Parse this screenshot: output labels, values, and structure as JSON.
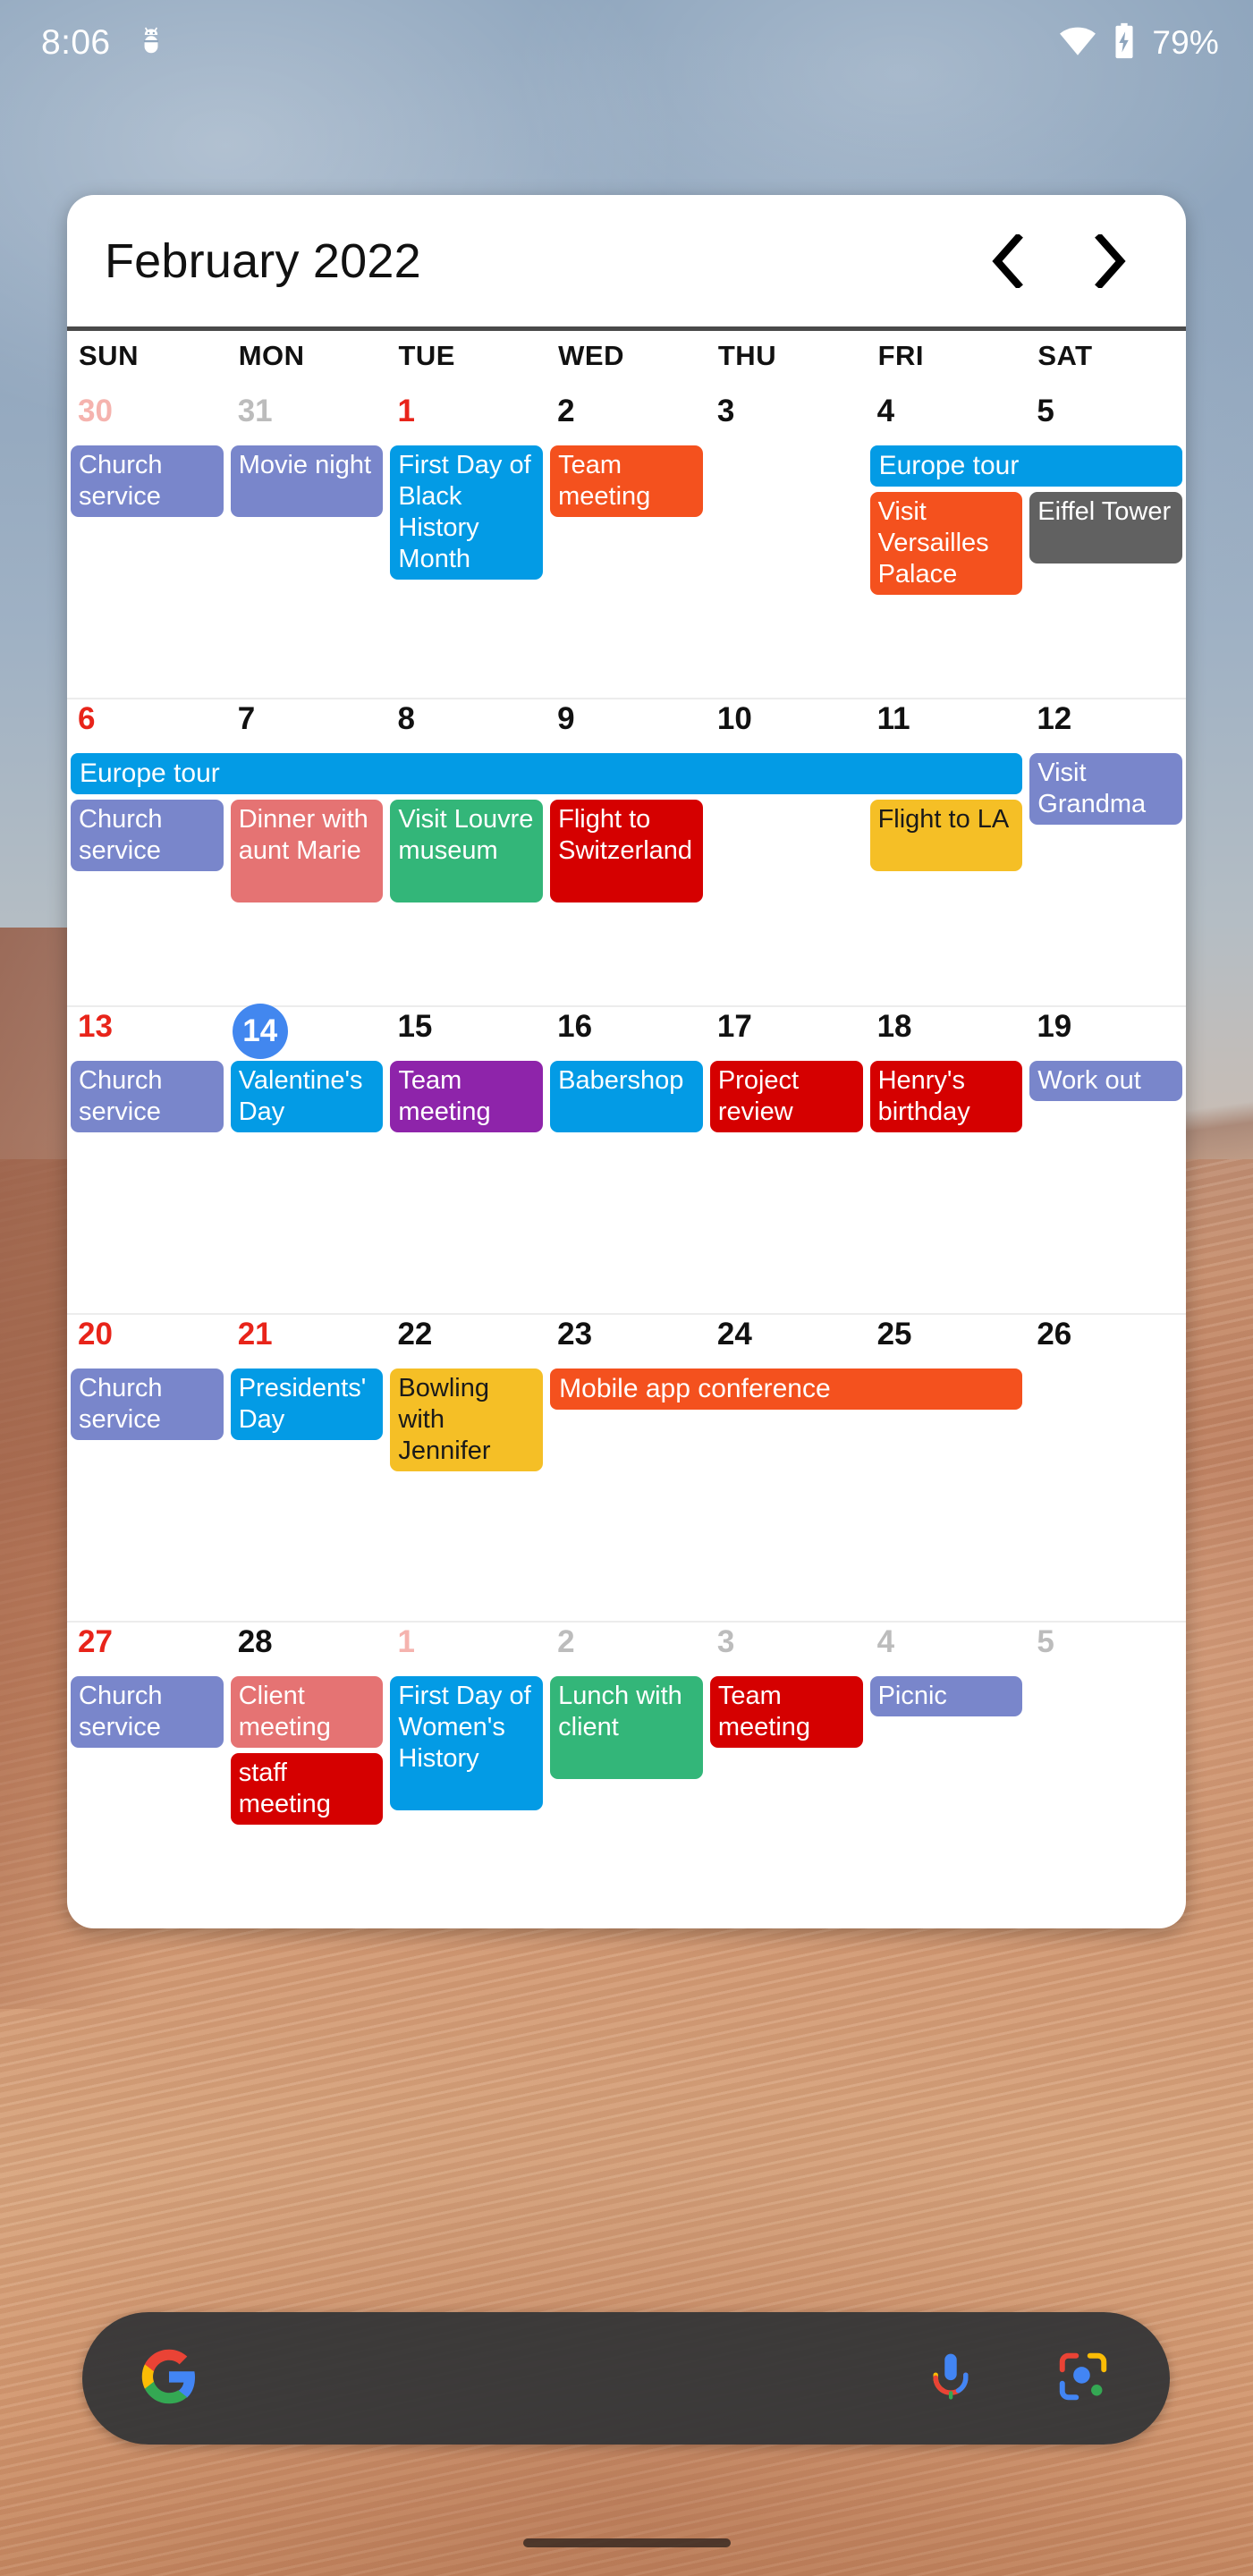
{
  "statusbar": {
    "time": "8:06",
    "debug_icon": "android-bug-icon",
    "wifi_icon": "wifi-icon",
    "battery_icon": "battery-charging-icon",
    "battery_percent": "79%"
  },
  "widget": {
    "title": "February 2022",
    "prev_label": "❮",
    "next_label": "❯",
    "weekdays": [
      "SUN",
      "MON",
      "TUE",
      "WED",
      "THU",
      "FRI",
      "SAT"
    ],
    "today": 14,
    "colors": {
      "periwinkle": "#7986cb",
      "blue": "#039be5",
      "orange": "#f4511e",
      "gray": "#616161",
      "salmon": "#e57373",
      "green": "#33b679",
      "red": "#d50000",
      "yellow": "#f5bf26",
      "purple": "#8e24aa",
      "today_circle": "#4287ef",
      "holiday_text": "#e8241a",
      "muted_text": "#bcbcbc"
    },
    "weeks": [
      {
        "days": [
          {
            "num": "30",
            "style": "out sun"
          },
          {
            "num": "31",
            "style": "out"
          },
          {
            "num": "1",
            "style": "hol"
          },
          {
            "num": "2",
            "style": ""
          },
          {
            "num": "3",
            "style": ""
          },
          {
            "num": "4",
            "style": ""
          },
          {
            "num": "5",
            "style": ""
          }
        ],
        "events": [
          {
            "title": "Church service",
            "col": 0,
            "span": 1,
            "row": 0,
            "lines": 2,
            "color": "periwinkle",
            "text": "light"
          },
          {
            "title": "Movie night",
            "col": 1,
            "span": 1,
            "row": 0,
            "lines": 2,
            "color": "periwinkle",
            "text": "light"
          },
          {
            "title": "First Day of Black History Month",
            "col": 2,
            "span": 1,
            "row": 0,
            "lines": 4,
            "color": "blue",
            "text": "light"
          },
          {
            "title": "Team meeting",
            "col": 3,
            "span": 1,
            "row": 0,
            "lines": 2,
            "color": "orange",
            "text": "light"
          },
          {
            "title": "Europe tour",
            "col": 5,
            "span": 2,
            "row": 0,
            "lines": 1,
            "color": "blue",
            "text": "light",
            "bar": true
          },
          {
            "title": "Visit Versailles Palace",
            "col": 5,
            "span": 1,
            "row": 1,
            "lines": 3,
            "color": "orange",
            "text": "light"
          },
          {
            "title": "Eiffel Tower",
            "col": 6,
            "span": 1,
            "row": 1,
            "lines": 2,
            "color": "gray",
            "text": "light"
          }
        ]
      },
      {
        "days": [
          {
            "num": "6",
            "style": "sun"
          },
          {
            "num": "7",
            "style": ""
          },
          {
            "num": "8",
            "style": ""
          },
          {
            "num": "9",
            "style": ""
          },
          {
            "num": "10",
            "style": ""
          },
          {
            "num": "11",
            "style": ""
          },
          {
            "num": "12",
            "style": ""
          }
        ],
        "events": [
          {
            "title": "Europe tour",
            "col": 0,
            "span": 6,
            "row": 0,
            "lines": 1,
            "color": "blue",
            "text": "light",
            "bar": true
          },
          {
            "title": "Church service",
            "col": 0,
            "span": 1,
            "row": 1,
            "lines": 2,
            "color": "periwinkle",
            "text": "light"
          },
          {
            "title": "Dinner with aunt Marie",
            "col": 1,
            "span": 1,
            "row": 1,
            "lines": 3,
            "color": "salmon",
            "text": "light"
          },
          {
            "title": "Visit Louvre museum",
            "col": 2,
            "span": 1,
            "row": 1,
            "lines": 3,
            "color": "green",
            "text": "light"
          },
          {
            "title": "Flight to Switzerland",
            "col": 3,
            "span": 1,
            "row": 1,
            "lines": 3,
            "color": "red",
            "text": "light"
          },
          {
            "title": "Flight to LA",
            "col": 5,
            "span": 1,
            "row": 1,
            "lines": 2,
            "color": "yellow",
            "text": "dark"
          },
          {
            "title": "Visit Grandma",
            "col": 6,
            "span": 1,
            "row": 0,
            "lines": 2,
            "color": "periwinkle",
            "text": "light"
          }
        ]
      },
      {
        "days": [
          {
            "num": "13",
            "style": "sun"
          },
          {
            "num": "14",
            "style": "today"
          },
          {
            "num": "15",
            "style": ""
          },
          {
            "num": "16",
            "style": ""
          },
          {
            "num": "17",
            "style": ""
          },
          {
            "num": "18",
            "style": ""
          },
          {
            "num": "19",
            "style": ""
          }
        ],
        "events": [
          {
            "title": "Church service",
            "col": 0,
            "span": 1,
            "row": 0,
            "lines": 2,
            "color": "periwinkle",
            "text": "light"
          },
          {
            "title": "Valentine's Day",
            "col": 1,
            "span": 1,
            "row": 0,
            "lines": 2,
            "color": "blue",
            "text": "light"
          },
          {
            "title": "Team meeting",
            "col": 2,
            "span": 1,
            "row": 0,
            "lines": 2,
            "color": "purple",
            "text": "light"
          },
          {
            "title": "Babershop",
            "col": 3,
            "span": 1,
            "row": 0,
            "lines": 2,
            "color": "blue",
            "text": "light"
          },
          {
            "title": "Project review",
            "col": 4,
            "span": 1,
            "row": 0,
            "lines": 2,
            "color": "red",
            "text": "light"
          },
          {
            "title": "Henry's birthday",
            "col": 5,
            "span": 1,
            "row": 0,
            "lines": 2,
            "color": "red",
            "text": "light"
          },
          {
            "title": "Work out",
            "col": 6,
            "span": 1,
            "row": 0,
            "lines": 1,
            "color": "periwinkle",
            "text": "light"
          }
        ]
      },
      {
        "days": [
          {
            "num": "20",
            "style": "sun"
          },
          {
            "num": "21",
            "style": "hol"
          },
          {
            "num": "22",
            "style": ""
          },
          {
            "num": "23",
            "style": ""
          },
          {
            "num": "24",
            "style": ""
          },
          {
            "num": "25",
            "style": ""
          },
          {
            "num": "26",
            "style": ""
          }
        ],
        "events": [
          {
            "title": "Church service",
            "col": 0,
            "span": 1,
            "row": 0,
            "lines": 2,
            "color": "periwinkle",
            "text": "light"
          },
          {
            "title": "Presidents' Day",
            "col": 1,
            "span": 1,
            "row": 0,
            "lines": 2,
            "color": "blue",
            "text": "light"
          },
          {
            "title": "Bowling with Jennifer",
            "col": 2,
            "span": 1,
            "row": 0,
            "lines": 3,
            "color": "yellow",
            "text": "dark"
          },
          {
            "title": "Mobile app conference",
            "col": 3,
            "span": 3,
            "row": 0,
            "lines": 1,
            "color": "orange",
            "text": "light",
            "bar": true
          }
        ]
      },
      {
        "days": [
          {
            "num": "27",
            "style": "sun"
          },
          {
            "num": "28",
            "style": ""
          },
          {
            "num": "1",
            "style": "out sun"
          },
          {
            "num": "2",
            "style": "out"
          },
          {
            "num": "3",
            "style": "out"
          },
          {
            "num": "4",
            "style": "out"
          },
          {
            "num": "5",
            "style": "out"
          }
        ],
        "events": [
          {
            "title": "Church service",
            "col": 0,
            "span": 1,
            "row": 0,
            "lines": 2,
            "color": "periwinkle",
            "text": "light"
          },
          {
            "title": "Client meeting",
            "col": 1,
            "span": 1,
            "row": 0,
            "lines": 2,
            "color": "salmon",
            "text": "light"
          },
          {
            "title": "staff meeting",
            "col": 1,
            "span": 1,
            "row": 1,
            "lines": 2,
            "color": "red",
            "text": "light"
          },
          {
            "title": "First Day of Women's History",
            "col": 2,
            "span": 1,
            "row": 0,
            "lines": 4,
            "color": "blue",
            "text": "light"
          },
          {
            "title": "Lunch with client",
            "col": 3,
            "span": 1,
            "row": 0,
            "lines": 3,
            "color": "green",
            "text": "light"
          },
          {
            "title": "Team meeting",
            "col": 4,
            "span": 1,
            "row": 0,
            "lines": 2,
            "color": "red",
            "text": "light"
          },
          {
            "title": "Picnic",
            "col": 5,
            "span": 1,
            "row": 0,
            "lines": 1,
            "color": "periwinkle",
            "text": "light"
          }
        ]
      }
    ]
  },
  "search": {
    "google_icon": "google-g-icon",
    "mic_icon": "microphone-icon",
    "lens_icon": "google-lens-icon"
  },
  "navbar": {
    "home_handle": "gesture-home-handle"
  }
}
